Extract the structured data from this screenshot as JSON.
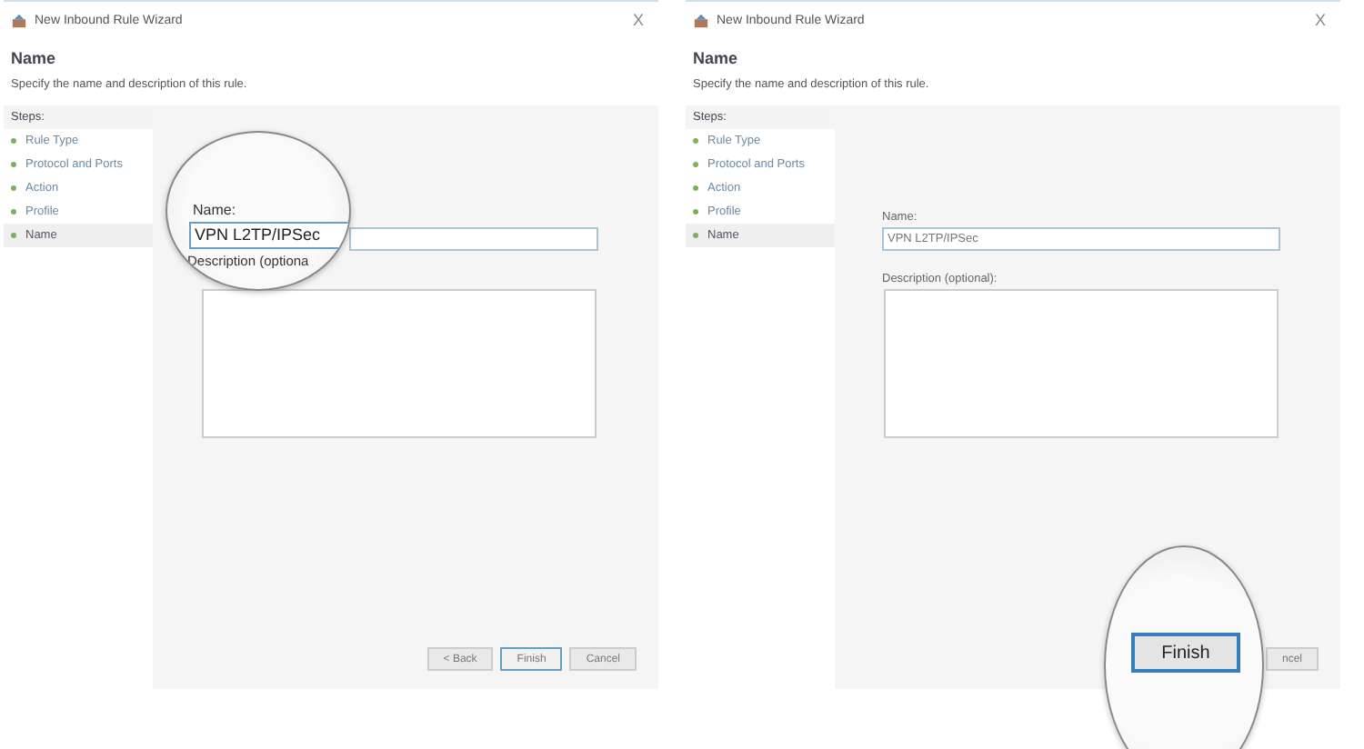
{
  "panels": [
    {
      "title": "New Inbound Rule Wizard",
      "close": "X",
      "heading": "Name",
      "subtitle": "Specify the name and description of this rule.",
      "steps_label": "Steps:",
      "steps": [
        {
          "label": "Rule Type",
          "selected": false
        },
        {
          "label": "Protocol and Ports",
          "selected": false
        },
        {
          "label": "Action",
          "selected": false
        },
        {
          "label": "Profile",
          "selected": false
        },
        {
          "label": "Name",
          "selected": true
        }
      ],
      "buttons": [
        {
          "label": "< Back",
          "default": false
        },
        {
          "label": "Finish",
          "default": true
        },
        {
          "label": "Cancel",
          "default": false
        }
      ],
      "lens": {
        "kind": "form",
        "name_label": "Name:",
        "name_value": "VPN L2TP/IPSec",
        "description_label": "Description (optiona"
      }
    },
    {
      "title": "New Inbound Rule Wizard",
      "close": "X",
      "heading": "Name",
      "subtitle": "Specify the name and description of this rule.",
      "steps_label": "Steps:",
      "steps": [
        {
          "label": "Rule Type",
          "selected": false
        },
        {
          "label": "Protocol and Ports",
          "selected": false
        },
        {
          "label": "Action",
          "selected": false
        },
        {
          "label": "Profile",
          "selected": false
        },
        {
          "label": "Name",
          "selected": true
        }
      ],
      "name_label": "Name:",
      "name_value": "VPN L2TP/IPSec",
      "description_label": "Description (optional):",
      "buttons": [
        {
          "label": "ncel",
          "default": false
        }
      ],
      "lens": {
        "kind": "button",
        "button_label": "Finish"
      }
    }
  ]
}
